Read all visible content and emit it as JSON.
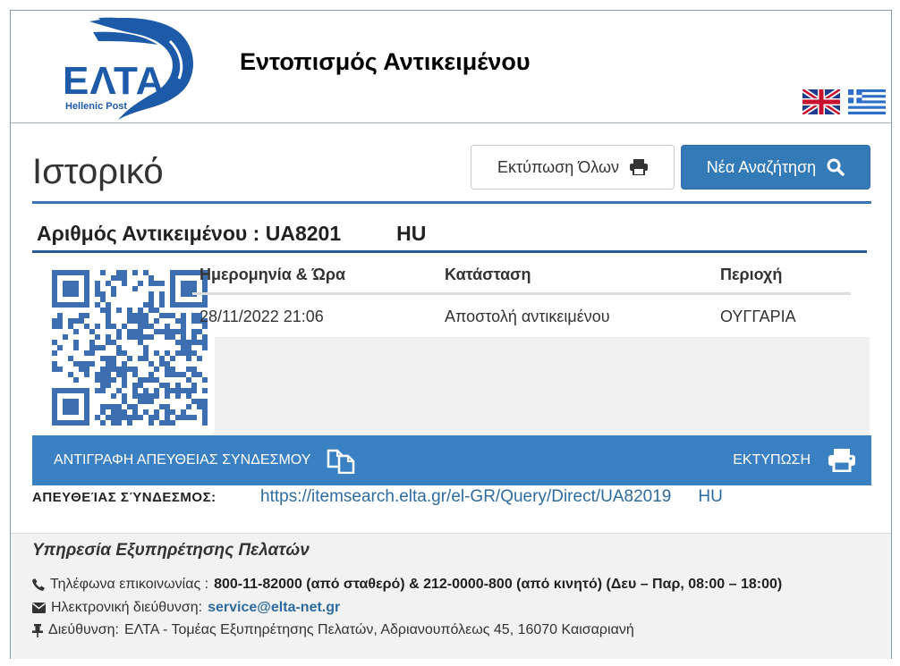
{
  "header": {
    "logo_text": "ΕΛΤΑ",
    "logo_sub": "Hellenic Post",
    "title": "Εντοπισμός Αντικειμένου",
    "languages": [
      "english-flag-icon",
      "greek-flag-icon"
    ]
  },
  "history": {
    "title": "Ιστορικό",
    "print_all_label": "Εκτύπωση Όλων",
    "new_search_label": "Νέα Αναζήτηση",
    "item_label": "Αριθμός Αντικειμένου : UA8201",
    "item_suffix": "HU"
  },
  "table": {
    "headers": [
      "Ημερομηνία & Ώρα",
      "Κατάσταση",
      "Περιοχή"
    ],
    "rows": [
      [
        "28/11/2022 21:06",
        "Αποστολή αντικειμένου",
        "ΟΥΓΓΑΡΙΑ"
      ]
    ]
  },
  "actions": {
    "copy_link_label": "ΑΝΤΙΓΡΑΦΗ ΑΠΕΥΘΕΙΑΣ ΣΥΝΔΕΣΜΟΥ",
    "print_label": "ΕΚΤΥΠΩΣΗ",
    "direct_link_label": "ΑΠΕΥΘΕΊΑΣ ΣΎΝΔΕΣΜΟΣ:",
    "direct_link_url": "https://itemsearch.elta.gr/el-GR/Query/Direct/UA82019",
    "direct_link_suffix": "HU"
  },
  "footer": {
    "title": "Υπηρεσία Εξυπηρέτησης Πελατών",
    "phone_label": "Τηλέφωνα επικοινωνίας :",
    "phone_value": "800-11-82000 (από σταθερό) & 212-0000-800 (από κινητό) (Δευ – Παρ, 08:00 – 18:00)",
    "email_label": "Ηλεκτρονική διεύθυνση:",
    "email_value": "service@elta-net.gr",
    "address_label": "Διεύθυνση:",
    "address_value": "ΕΛΤΑ - Τομέας Εξυπηρέτησης Πελατών, Αδριανουπόλεως 45, 16070 Καισαριανή"
  },
  "colors": {
    "brand_blue": "#1d5aa8",
    "button_blue": "#337ab7",
    "bar_blue": "#3a80c2",
    "link_blue": "#2e6b9f"
  }
}
